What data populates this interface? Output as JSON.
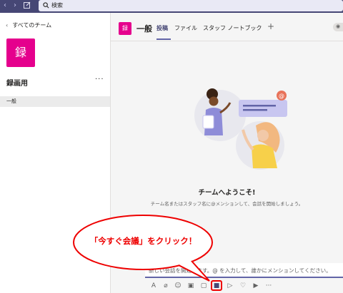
{
  "topbar": {
    "back_icon": "chevron-left-icon",
    "forward_icon": "chevron-right-icon",
    "compose_icon": "compose-icon",
    "search_placeholder": "検索"
  },
  "sidebar": {
    "back_label": "すべてのチーム",
    "team_tile_text": "録",
    "team_name": "録画用",
    "more": "···",
    "channels": [
      {
        "label": "一般"
      }
    ]
  },
  "header": {
    "tile_text": "録",
    "title": "一般",
    "tabs": [
      {
        "label": "投稿",
        "active": true
      },
      {
        "label": "ファイル",
        "active": false
      },
      {
        "label": "スタッフ ノートブック",
        "active": false
      }
    ],
    "add_tab": "+"
  },
  "main": {
    "welcome_title": "チームへようこそ!",
    "welcome_sub": "チーム名またはスタッフ名に@メンションして、会話を開始しましょう。",
    "compose_placeholder": "新しい会話を開始します。@ を入力して、誰かにメンションしてください。"
  },
  "toolbar": {
    "icons": [
      "format-icon",
      "attach-icon",
      "emoji-icon",
      "gif-icon",
      "sticker-icon",
      "meet-now-icon",
      "stream-icon",
      "praise-icon",
      "video-icon",
      "more-icon"
    ]
  },
  "callout": {
    "text": "「今すぐ会議」をクリック！",
    "color": "#e00000"
  },
  "colors": {
    "brand": "#464775",
    "accent": "#6264a7",
    "team": "#e5008d"
  }
}
